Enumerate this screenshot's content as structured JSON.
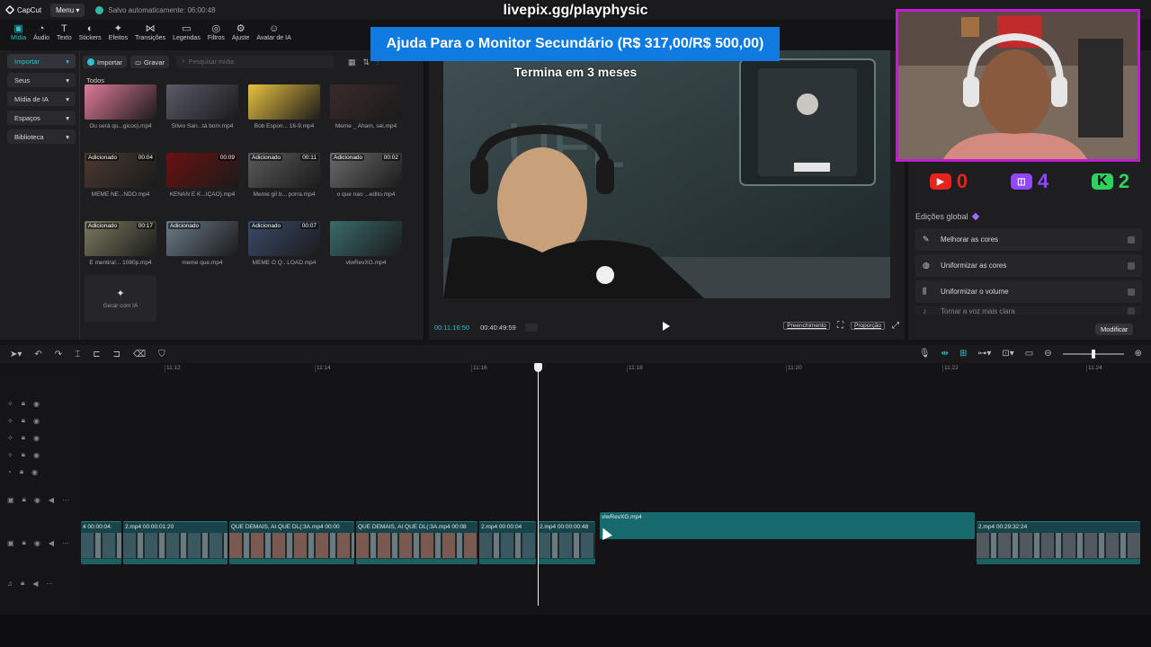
{
  "app": {
    "name": "CapCut",
    "menu_label": "Menu",
    "autosave_text": "Salvo automaticamente: 06:00:48",
    "stream_url": "livepix.gg/playphysic"
  },
  "tool_tabs": [
    {
      "label": "Mídia",
      "icon": "media-icon",
      "glyph": "▣"
    },
    {
      "label": "Áudio",
      "icon": "audio-icon",
      "glyph": "◔"
    },
    {
      "label": "Texto",
      "icon": "text-icon",
      "glyph": "T"
    },
    {
      "label": "Stickers",
      "icon": "sticker-icon",
      "glyph": "◐"
    },
    {
      "label": "Efeitos",
      "icon": "effects-icon",
      "glyph": "✦"
    },
    {
      "label": "Transições",
      "icon": "transitions-icon",
      "glyph": "⋈"
    },
    {
      "label": "Legendas",
      "icon": "captions-icon",
      "glyph": "▭"
    },
    {
      "label": "Filtros",
      "icon": "filters-icon",
      "glyph": "◎"
    },
    {
      "label": "Ajuste",
      "icon": "adjust-icon",
      "glyph": "⚙"
    },
    {
      "label": "Avatar de IA",
      "icon": "ai-avatar-icon",
      "glyph": "☺"
    }
  ],
  "sidebar": {
    "items": [
      {
        "label": "Importar",
        "active": true
      },
      {
        "label": "Seus"
      },
      {
        "label": "Mídia de IA"
      },
      {
        "label": "Espaços"
      },
      {
        "label": "Biblioteca"
      }
    ]
  },
  "media_toolbar": {
    "import_label": "Importar",
    "record_label": "Gravar",
    "search_placeholder": "Pesquisar mídia"
  },
  "media": {
    "section_label": "Todos",
    "items": [
      {
        "name": "Ou será qu...gicos).mp4",
        "badge": "",
        "duration": "",
        "color": "#e07a9a"
      },
      {
        "name": "Silvio San...tá bom.mp4",
        "badge": "",
        "duration": "",
        "color": "#5a5a6a"
      },
      {
        "name": "Bob Espon... 16-9.mp4",
        "badge": "",
        "duration": "",
        "color": "#e8c040"
      },
      {
        "name": "Meme _ Aham, sei.mp4",
        "badge": "",
        "duration": "",
        "color": "#3a2a2a"
      },
      {
        "name": "MEME NE...NDO.mp4",
        "badge": "Adicionado",
        "duration": "00:04",
        "color": "#4a3a30"
      },
      {
        "name": "KENAN E K...IÇÃO).mp4",
        "badge": "",
        "duration": "00:09",
        "color": "#6a1010"
      },
      {
        "name": "Meme gil b... porra.mp4",
        "badge": "Adicionado",
        "duration": "00:11",
        "color": "#5a5a5a"
      },
      {
        "name": "o que nao ...edito.mp4",
        "badge": "Adicionado",
        "duration": "00:02",
        "color": "#6a6a6a"
      },
      {
        "name": "É mentira!... 1080p.mp4",
        "badge": "Adicionado",
        "duration": "00:17",
        "color": "#7a7a60"
      },
      {
        "name": "meme que.mp4",
        "badge": "Adicionado",
        "duration": "",
        "color": "#6a7a8a"
      },
      {
        "name": "MEME O Q...LOAD.mp4",
        "badge": "Adicionado",
        "duration": "00:07",
        "color": "#3a4a6a"
      },
      {
        "name": "vlwRevXG.mp4",
        "badge": "",
        "duration": "",
        "color": "#3a6a6a"
      }
    ],
    "generate_ai_label": "Gerar com IA"
  },
  "overlay": {
    "donation_banner": "Ajuda Para o Monitor Secundário (R$ 317,00/R$ 500,00)",
    "ends_label": "Termina em 3 meses"
  },
  "player": {
    "current_time": "00:11:16:50",
    "total_time": "00:40:49:59",
    "fill_label": "Preenchimento",
    "ratio_label": "Proporção"
  },
  "stats": {
    "youtube": "0",
    "twitch": "4",
    "kick": "2"
  },
  "right_panel": {
    "title": "Edições global",
    "items": [
      {
        "label": "Melhorar as cores",
        "icon": "wand-icon",
        "glyph": "✎"
      },
      {
        "label": "Uniformizar as cores",
        "icon": "palette-icon",
        "glyph": "◍"
      },
      {
        "label": "Uniformizar o volume",
        "icon": "volume-bars-icon",
        "glyph": "⫼"
      },
      {
        "label": "Tornar a voz mais clara",
        "icon": "voice-icon",
        "glyph": "♪"
      }
    ],
    "modify_label": "Modificar"
  },
  "ruler_ticks": [
    "11:12",
    "11:14",
    "11:16",
    "11:18",
    "11:20",
    "11:22",
    "11:24"
  ],
  "clips": [
    {
      "label": "4  00:00:04:",
      "type": "video",
      "color": "#3a5860"
    },
    {
      "label": "2.mp4  00:00:01:20",
      "type": "video",
      "color": "#3a5860"
    },
    {
      "label": "QUE DEMAIS, AI QUE DL(:3A.mp4  00:00",
      "type": "video",
      "color": "#7a5a50"
    },
    {
      "label": "QUE DEMAIS, AI QUE DL(:3A.mp4  00:08",
      "type": "video",
      "color": "#7a5a50"
    },
    {
      "label": "2.mp4  00:00:04",
      "type": "video",
      "color": "#3a5860"
    },
    {
      "label": "2.mp4  00:00:00:48",
      "type": "video",
      "color": "#3a5860"
    },
    {
      "label": "vlwRevXG.mp4",
      "type": "selected",
      "color": "#166a6d"
    },
    {
      "label": "2.mp4  00:29:32:24",
      "type": "video",
      "color": "#505a5e"
    }
  ]
}
